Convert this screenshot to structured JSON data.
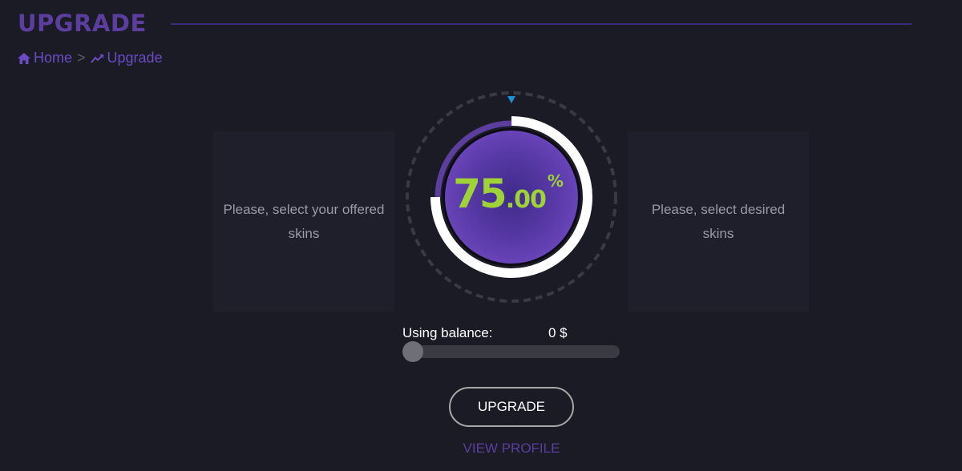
{
  "page": {
    "title": "UPGRADE"
  },
  "breadcrumb": {
    "home_label": "Home",
    "separator": ">",
    "current_label": "Upgrade",
    "home_icon": "home-icon",
    "current_icon": "trending-up-icon"
  },
  "offered_panel": {
    "text": "Please, select your offered skins"
  },
  "desired_panel": {
    "text": "Please, select desired skins"
  },
  "chance": {
    "value": 75.0,
    "integer_part": "75",
    "decimal_part": ".00",
    "unit": "%",
    "pointer_icon": "triangle-down-icon"
  },
  "balance": {
    "label": "Using balance:",
    "value": "0 $",
    "slider_fraction": 0
  },
  "actions": {
    "upgrade_label": "UPGRADE",
    "view_profile_label": "VIEW PROFILE"
  },
  "colors": {
    "background": "#1b1b26",
    "panel": "#1f1f2c",
    "accent_purple": "#5b3e9e",
    "chance_green": "#9ed237",
    "pointer_blue": "#1d8fd6",
    "ring_white": "#ffffff"
  }
}
